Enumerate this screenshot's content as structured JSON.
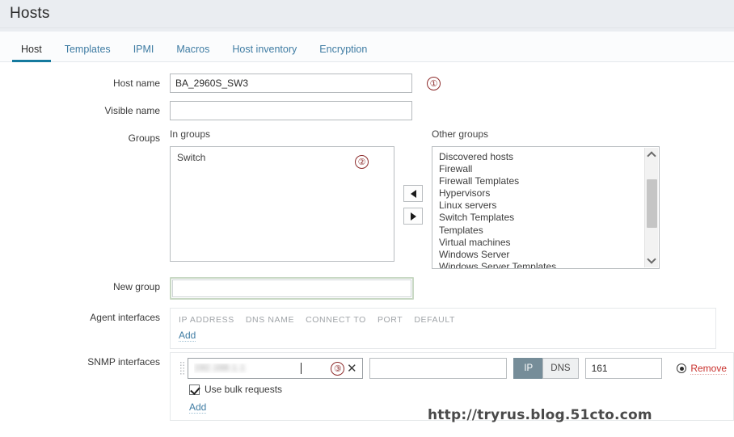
{
  "header": {
    "title": "Hosts"
  },
  "tabs": [
    {
      "label": "Host",
      "active": true
    },
    {
      "label": "Templates",
      "active": false
    },
    {
      "label": "IPMI",
      "active": false
    },
    {
      "label": "Macros",
      "active": false
    },
    {
      "label": "Host inventory",
      "active": false
    },
    {
      "label": "Encryption",
      "active": false
    }
  ],
  "form": {
    "host_name": {
      "label": "Host name",
      "value": "BA_2960S_SW3",
      "placeholder": ""
    },
    "visible_name": {
      "label": "Visible name",
      "value": "",
      "placeholder": ""
    },
    "groups": {
      "label": "Groups",
      "in_groups_caption": "In groups",
      "other_groups_caption": "Other groups",
      "in_groups": [
        "Switch"
      ],
      "other_groups": [
        "Discovered hosts",
        "Firewall",
        "Firewall Templates",
        "Hypervisors",
        "Linux servers",
        "Switch Templates",
        "Templates",
        "Virtual machines",
        "Windows Server",
        "Windows Server Templates"
      ],
      "move_left_icon": "triangle-left-icon",
      "move_right_icon": "triangle-right-icon"
    },
    "new_group": {
      "label": "New group",
      "value": "",
      "placeholder": ""
    },
    "agent_interfaces": {
      "label": "Agent interfaces",
      "columns": [
        "IP ADDRESS",
        "DNS NAME",
        "CONNECT TO",
        "PORT",
        "DEFAULT"
      ],
      "add_label": "Add"
    },
    "snmp_interfaces": {
      "label": "SNMP interfaces",
      "ip_value": "192.168.1.1",
      "ip_redacted": true,
      "dns_value": "",
      "connect_to": {
        "options": [
          "IP",
          "DNS"
        ],
        "selected": "IP"
      },
      "port_value": "161",
      "default_selected": true,
      "remove_label": "Remove",
      "clear_icon": "close-icon",
      "drag_icon": "drag-handle-icon",
      "bulk_requests": {
        "label": "Use bulk requests",
        "checked": true
      },
      "add_label": "Add"
    }
  },
  "annotations": [
    {
      "marker": "①",
      "target": "host-name-field"
    },
    {
      "marker": "②",
      "target": "in-groups-listbox"
    },
    {
      "marker": "③",
      "target": "snmp-ip-field"
    }
  ],
  "watermark": {
    "text": "http://tryrus.blog.51cto.com"
  },
  "colors": {
    "accent": "#157a9e",
    "link": "#3f7ca3",
    "header_bg": "#eaedf1",
    "annotation": "#8d2b2b",
    "segment_on_bg": "#768d99",
    "focus_border": "#c8d8c4"
  }
}
